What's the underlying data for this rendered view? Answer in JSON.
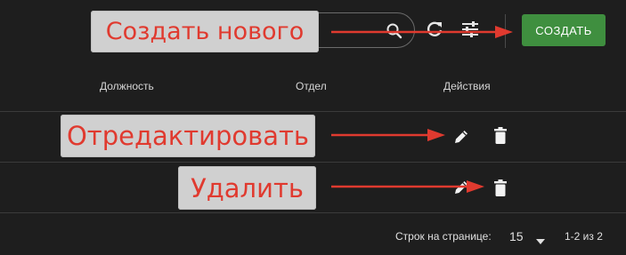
{
  "toolbar": {
    "search_placeholder": "",
    "create_label": "СОЗДАТЬ"
  },
  "table": {
    "columns": [
      "Должность",
      "Отдел",
      "Действия"
    ]
  },
  "annotations": {
    "create_new": "Создать нового",
    "edit": "Отредактировать",
    "delete": "Удалить",
    "color": "#e03a2f",
    "background": "#d0d0d0"
  },
  "pagination": {
    "rows_per_page_label": "Строк на странице:",
    "rows_per_page_value": "15",
    "range": "1-2 из 2"
  },
  "colors": {
    "background": "#1e1e1e",
    "create_button": "#3f8f3f",
    "divider": "#3b3b3b"
  },
  "icons": [
    "search-icon",
    "refresh-icon",
    "tune-icon",
    "pencil-icon",
    "trash-icon",
    "caret-down-icon"
  ]
}
